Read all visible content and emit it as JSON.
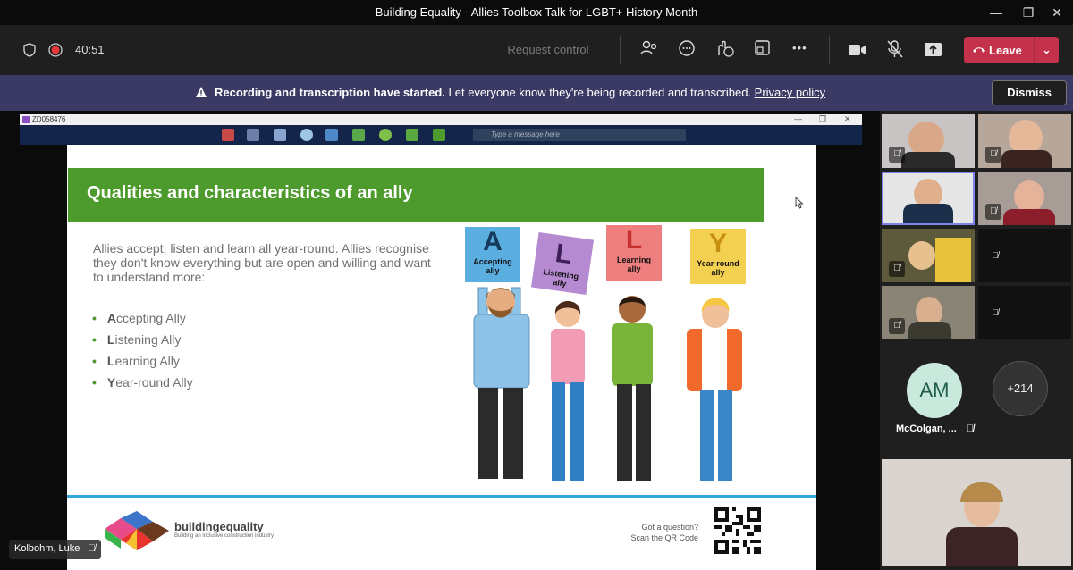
{
  "window": {
    "title": "Building Equality - Allies Toolbox Talk for LGBT+ History Month",
    "minimize_glyph": "—",
    "maximize_glyph": "❐",
    "close_glyph": "✕"
  },
  "toolbar": {
    "timer": "40:51",
    "request_control": "Request control",
    "leave_label": "Leave",
    "leave_dropdown_glyph": "⌄",
    "more_glyph": "•••"
  },
  "banner": {
    "title": "Recording and transcription have started.",
    "message": "Let everyone know they're being recorded and transcribed.",
    "link": "Privacy policy",
    "dismiss": "Dismiss"
  },
  "remote_desktop": {
    "session_id": "ZD058476",
    "message_placeholder": "Type a message here"
  },
  "slide": {
    "title": "Qualities and characteristics of an ally",
    "body": "Allies accept, listen and learn all year-round. Allies recognise they don't know everything but are open and willing and want to understand more:",
    "bullets": [
      {
        "first": "A",
        "rest": "ccepting Ally"
      },
      {
        "first": "L",
        "rest": "istening Ally"
      },
      {
        "first": "L",
        "rest": "earning Ally"
      },
      {
        "first": "Y",
        "rest": "ear-round Ally"
      }
    ],
    "signs": [
      {
        "letter": "A",
        "word1": "Accepting",
        "word2": "ally",
        "color": "#5aaee0"
      },
      {
        "letter": "L",
        "word1": "Listening",
        "word2": "ally",
        "color": "#b58ad0"
      },
      {
        "letter": "L",
        "word1": "Learning",
        "word2": "ally",
        "color": "#ef7f7f"
      },
      {
        "letter": "Y",
        "word1": "Year-round",
        "word2": "ally",
        "color": "#f3d04f"
      }
    ],
    "logo_text": "buildingequality",
    "logo_sub": "Building an inclusive construction industry",
    "qr_text_1": "Got a question?",
    "qr_text_2": "Scan the QR Code"
  },
  "speaker": {
    "name": "Kolbohm, Luke"
  },
  "participants": {
    "am_initials": "AM",
    "am_name": "McColgan, ...",
    "overflow": "+214"
  },
  "colors": {
    "leave": "#c4314b",
    "banner": "#3b3a64",
    "slide_green": "#4d9a2d",
    "slide_rule": "#2ea8d8"
  }
}
